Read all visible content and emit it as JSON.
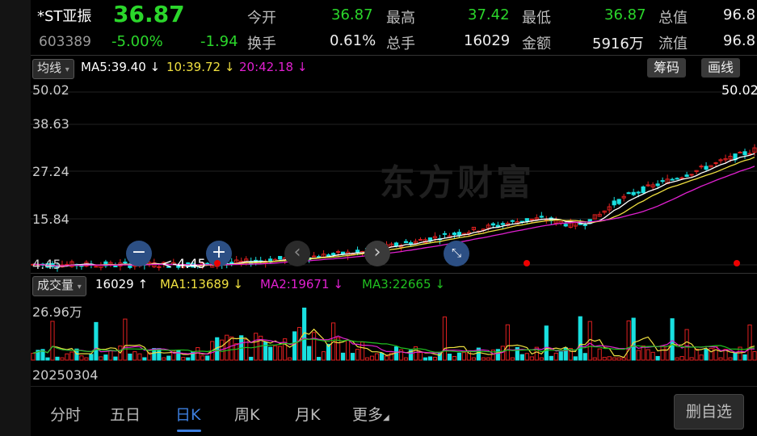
{
  "stock": {
    "name": "*ST亚振",
    "code": "603389",
    "price": "36.87",
    "change_pct": "-5.00%",
    "change": "-1.94"
  },
  "quote": {
    "open_label": "今开",
    "open": "36.87",
    "high_label": "最高",
    "high": "37.42",
    "low_label": "最低",
    "low": "36.87",
    "mktcap_label": "总值",
    "mktcap": "96.8",
    "turnover_label": "换手",
    "turnover": "0.61%",
    "volume_label": "总手",
    "volume": "16029",
    "amount_label": "金额",
    "amount": "5916万",
    "float_label": "流值",
    "float": "96.8"
  },
  "ma_bar": {
    "selector": "均线",
    "ma5": "MA5:39.40",
    "ma10": "10:39.72",
    "ma20": "20:42.18",
    "chip_btn": "筹码",
    "draw_btn": "画线"
  },
  "price_axis": [
    "50.02",
    "38.63",
    "27.24",
    "15.84",
    "4.45"
  ],
  "price_annotations": {
    "max": "50.02",
    "min": "<-4.45"
  },
  "watermark": "东方财富",
  "vol_bar": {
    "selector": "成交量",
    "vol": "16029",
    "ma1": "MA1:13689",
    "ma2": "MA2:19671",
    "ma3": "MA3:22665"
  },
  "vol_axis_top": "26.96万",
  "date_label": "20250304",
  "tabs": [
    "分时",
    "五日",
    "日K",
    "周K",
    "月K",
    "更多"
  ],
  "active_tab": 2,
  "remove_btn": "删自选",
  "colors": {
    "up": "#e02020",
    "down": "#19e0e0",
    "ma5": "#ffffff",
    "ma10": "#f0e040",
    "ma20": "#e020d0",
    "vol_ma3": "#20c020",
    "accent": "#3d7fe0"
  }
}
